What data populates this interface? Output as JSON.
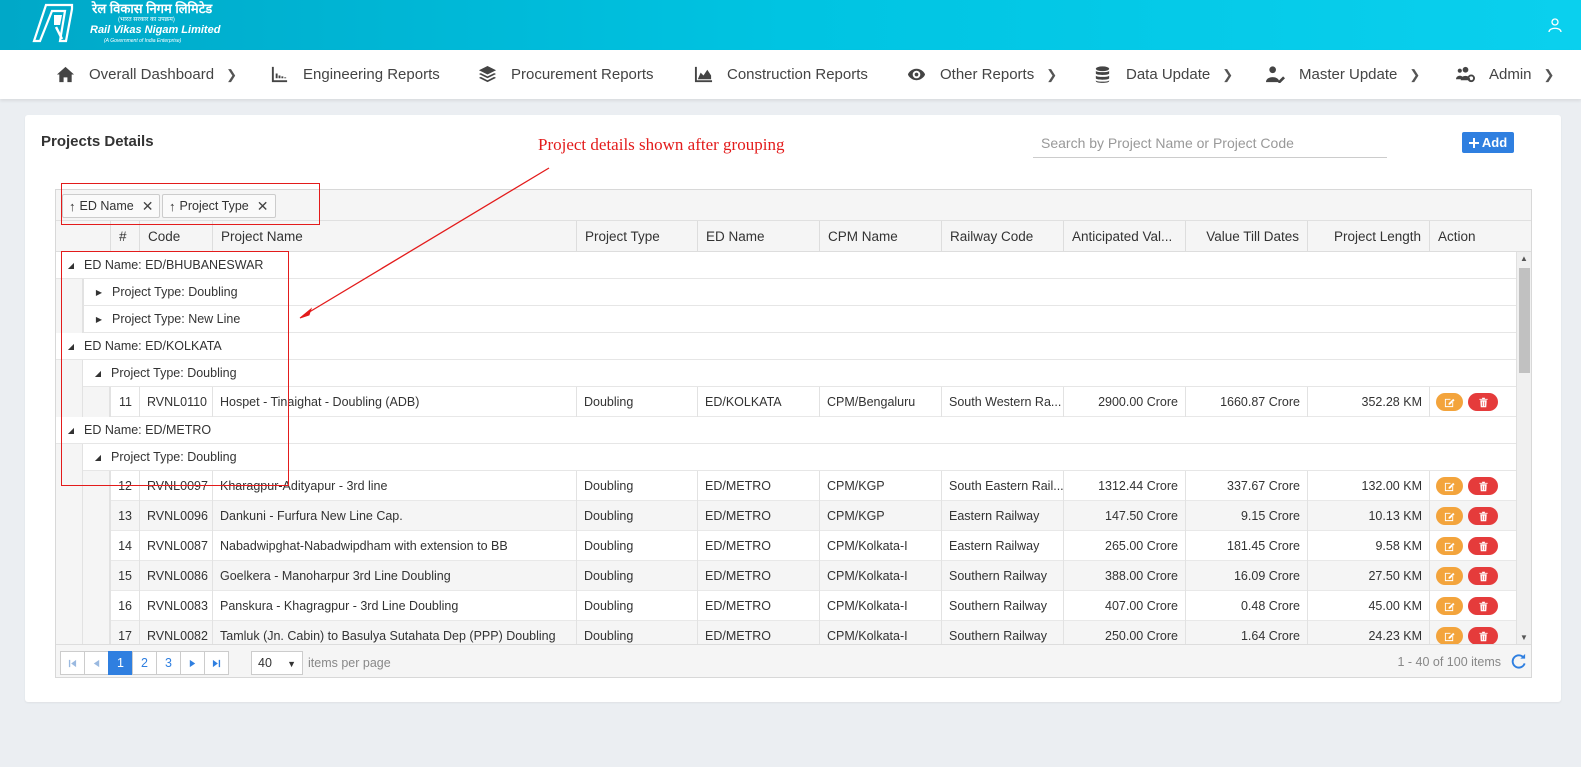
{
  "brand": {
    "hindi_name": "रेल विकास निगम लिमिटेड",
    "hindi_sub": "(भारत सरकार का उपक्रम)",
    "english_name": "Rail Vikas Nigam Limited",
    "gov_line": "(A Government of India Enterprise)"
  },
  "nav": [
    {
      "label": "Overall Dashboard",
      "icon": "home-icon",
      "has_submenu": true
    },
    {
      "label": "Engineering Reports",
      "icon": "engineering-icon",
      "has_submenu": false
    },
    {
      "label": "Procurement Reports",
      "icon": "layers-icon",
      "has_submenu": false
    },
    {
      "label": "Construction Reports",
      "icon": "area-chart-icon",
      "has_submenu": false
    },
    {
      "label": "Other Reports",
      "icon": "eye-icon",
      "has_submenu": true
    },
    {
      "label": "Data Update",
      "icon": "database-icon",
      "has_submenu": true
    },
    {
      "label": "Master Update",
      "icon": "user-edit-icon",
      "has_submenu": true
    },
    {
      "label": "Admin",
      "icon": "users-cog-icon",
      "has_submenu": true
    }
  ],
  "card": {
    "title": "Projects Details",
    "search_placeholder": "Search by Project Name or Project Code",
    "add_label": "Add"
  },
  "annotation": "Project details shown after grouping",
  "grouping": [
    {
      "label": "ED Name",
      "direction": "asc"
    },
    {
      "label": "Project Type",
      "direction": "asc"
    }
  ],
  "columns": [
    "#",
    "Code",
    "Project Name",
    "Project Type",
    "ED Name",
    "CPM Name",
    "Railway Code",
    "Anticipated Val...",
    "Value Till Dates",
    "Project Length",
    "Action"
  ],
  "groups": [
    {
      "label": "ED Name: ED/BHUBANESWAR",
      "expanded": true,
      "subgroups": [
        {
          "label": "Project Type: Doubling",
          "expanded": false
        },
        {
          "label": "Project Type: New Line",
          "expanded": false
        }
      ]
    },
    {
      "label": "ED Name: ED/KOLKATA",
      "expanded": true,
      "subgroups": [
        {
          "label": "Project Type: Doubling",
          "expanded": true
        }
      ]
    },
    {
      "label": "ED Name: ED/METRO",
      "expanded": true,
      "subgroups": [
        {
          "label": "Project Type: Doubling",
          "expanded": true
        }
      ]
    }
  ],
  "rows": [
    {
      "num": "11",
      "code": "RVNL0110",
      "name": "Hospet - Tinaighat - Doubling (ADB)",
      "type": "Doubling",
      "ed": "ED/KOLKATA",
      "cpm": "CPM/Bengaluru",
      "railway": "South Western Ra...",
      "anticipated": "2900.00 Crore",
      "till_date": "1660.87 Crore",
      "length": "352.28 KM"
    },
    {
      "num": "12",
      "code": "RVNL0097",
      "name": "Kharagpur-Adityapur - 3rd line",
      "type": "Doubling",
      "ed": "ED/METRO",
      "cpm": "CPM/KGP",
      "railway": "South Eastern Rail...",
      "anticipated": "1312.44 Crore",
      "till_date": "337.67 Crore",
      "length": "132.00 KM"
    },
    {
      "num": "13",
      "code": "RVNL0096",
      "name": "Dankuni - Furfura New Line Cap.",
      "type": "Doubling",
      "ed": "ED/METRO",
      "cpm": "CPM/KGP",
      "railway": "Eastern Railway",
      "anticipated": "147.50 Crore",
      "till_date": "9.15 Crore",
      "length": "10.13 KM"
    },
    {
      "num": "14",
      "code": "RVNL0087",
      "name": "Nabadwipghat-Nabadwipdham with extension to BB",
      "type": "Doubling",
      "ed": "ED/METRO",
      "cpm": "CPM/Kolkata-I",
      "railway": "Eastern Railway",
      "anticipated": "265.00 Crore",
      "till_date": "181.45 Crore",
      "length": "9.58 KM"
    },
    {
      "num": "15",
      "code": "RVNL0086",
      "name": "Goelkera - Manoharpur 3rd Line Doubling",
      "type": "Doubling",
      "ed": "ED/METRO",
      "cpm": "CPM/Kolkata-I",
      "railway": "Southern Railway",
      "anticipated": "388.00 Crore",
      "till_date": "16.09 Crore",
      "length": "27.50 KM"
    },
    {
      "num": "16",
      "code": "RVNL0083",
      "name": "Panskura - Khagragpur - 3rd Line Doubling",
      "type": "Doubling",
      "ed": "ED/METRO",
      "cpm": "CPM/Kolkata-I",
      "railway": "Southern Railway",
      "anticipated": "407.00 Crore",
      "till_date": "0.48 Crore",
      "length": "45.00 KM"
    },
    {
      "num": "17",
      "code": "RVNL0082",
      "name": "Tamluk (Jn. Cabin) to Basulya Sutahata Dep (PPP) Doubling",
      "type": "Doubling",
      "ed": "ED/METRO",
      "cpm": "CPM/Kolkata-I",
      "railway": "Southern Railway",
      "anticipated": "250.00 Crore",
      "till_date": "1.64 Crore",
      "length": "24.23 KM"
    }
  ],
  "pager": {
    "pages": [
      "1",
      "2",
      "3"
    ],
    "current": "1",
    "page_size": "40",
    "per_page_label": "items per page",
    "info": "1 - 40 of 100 items"
  },
  "colors": {
    "header": "#00bcd9",
    "accent": "#2f7fe0",
    "edit": "#f3a43c",
    "delete": "#e53b3b",
    "annotation": "#e31b1b"
  }
}
